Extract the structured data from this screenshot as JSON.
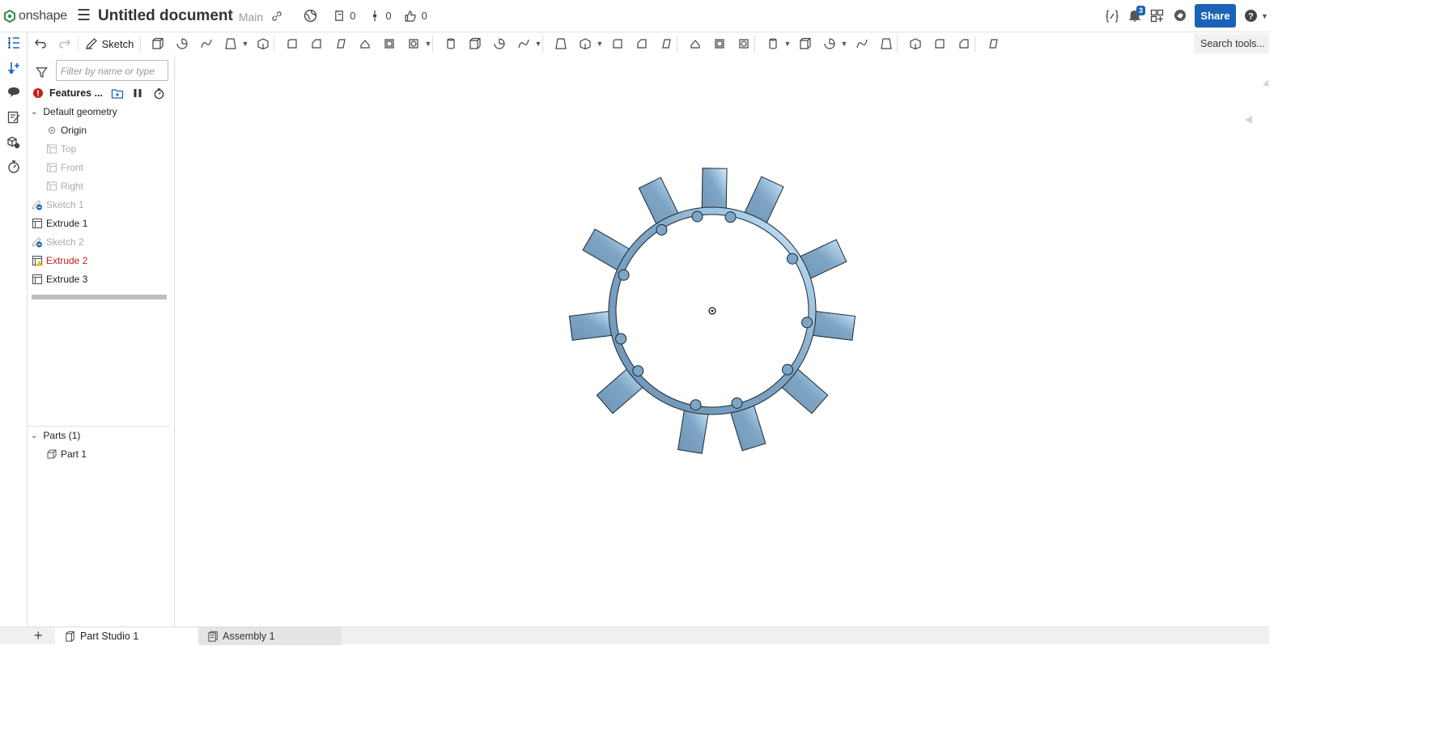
{
  "app": {
    "logo_text": "onshape",
    "title": "Untitled document",
    "branch": "Main",
    "counts": {
      "versions": "0",
      "branches": "0",
      "likes": "0"
    },
    "notifications": "3",
    "share_label": "Share"
  },
  "toolbar": {
    "sketch_label": "Sketch",
    "search_label": "Search tools...",
    "icons": [
      "undo-icon",
      "redo-icon",
      "sketch-icon",
      "extrude-icon",
      "revolve-icon",
      "sweep-icon",
      "loft-icon",
      "thicken-icon",
      "fillet-icon",
      "chamfer-icon",
      "draft-icon",
      "rib-icon",
      "shell-icon",
      "hole-icon",
      "linear-pattern-icon",
      "mirror-icon",
      "boolean-icon",
      "split-icon",
      "transform-icon",
      "delete-part-icon",
      "modify-fillet-icon",
      "delete-face-icon",
      "move-face-icon",
      "replace-face-icon",
      "offset-surface-icon",
      "plane-icon",
      "mate-connector-icon",
      "helix-icon",
      "measure-icon",
      "variable-icon",
      "configuration-icon",
      "tag-icon",
      "sheet-metal-icon",
      "frame-icon",
      "text-icon"
    ]
  },
  "feature_panel": {
    "filter_placeholder": "Filter by name or type",
    "features_label": "Features ...",
    "default_geometry_label": "Default geometry",
    "default_items": [
      "Origin",
      "Top",
      "Front",
      "Right"
    ],
    "features": [
      {
        "label": "Sketch 1",
        "state": "dim",
        "icon": "sketch-icon"
      },
      {
        "label": "Extrude 1",
        "state": "normal",
        "icon": "extrude-icon"
      },
      {
        "label": "Sketch 2",
        "state": "dim",
        "icon": "sketch-icon"
      },
      {
        "label": "Extrude 2",
        "state": "error",
        "icon": "extrude-warning-icon"
      },
      {
        "label": "Extrude 3",
        "state": "normal",
        "icon": "extrude-icon"
      }
    ],
    "parts_label": "Parts (1)",
    "parts": [
      "Part 1"
    ]
  },
  "tabs": [
    {
      "label": "Part Studio 1",
      "active": true
    },
    {
      "label": "Assembly 1",
      "active": false
    }
  ],
  "colors": {
    "accent": "#1a63b6",
    "part_fill": "#7ba2c2",
    "part_highlight": "#d6ecfb",
    "error": "#c81e1e"
  }
}
